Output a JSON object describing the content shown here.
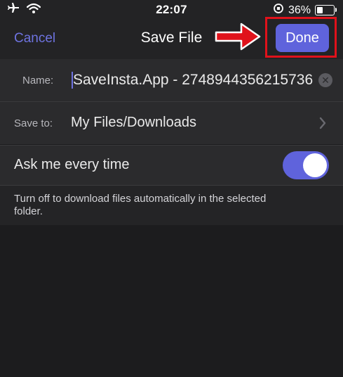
{
  "status_bar": {
    "time": "22:07",
    "battery_percent": "36%",
    "battery_level": 0.36,
    "icons": [
      "airplane-icon",
      "wifi-icon",
      "orientation-lock-icon",
      "battery-icon"
    ]
  },
  "nav": {
    "cancel_label": "Cancel",
    "title": "Save File",
    "done_label": "Done",
    "highlight_color": "#e0121b",
    "accent_color": "#5f63dc"
  },
  "form": {
    "name_label": "Name:",
    "name_value": "SaveInsta.App - 2748944356215736",
    "save_to_label": "Save to:",
    "save_to_value": "My Files/Downloads",
    "ask_label": "Ask me every time",
    "ask_toggle_on": true,
    "footer_text": "Turn off to download files automatically in the selected folder."
  }
}
